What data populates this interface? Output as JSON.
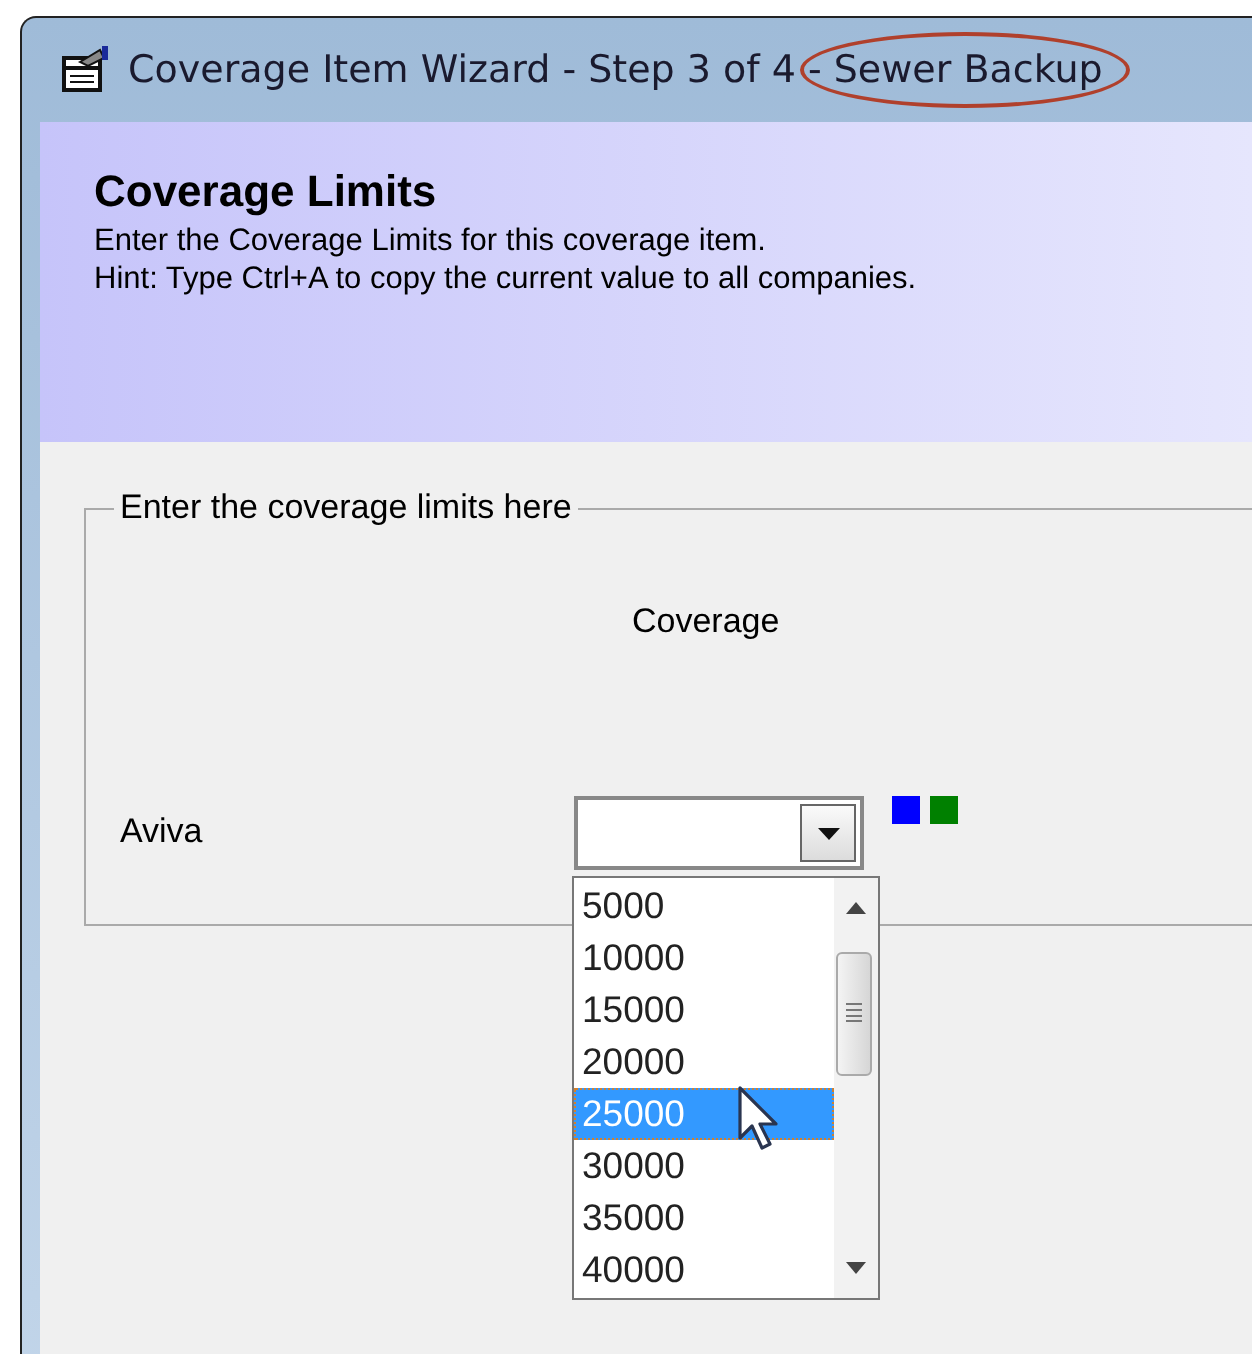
{
  "window": {
    "title": "Coverage Item Wizard - Step 3 of 4",
    "title_highlight": "- Sewer Backup"
  },
  "header": {
    "heading": "Coverage Limits",
    "lines": [
      "Enter the Coverage Limits for this coverage item.",
      "Hint: Type Ctrl+A to copy the current value to all companies."
    ]
  },
  "group": {
    "legend": "Enter the coverage limits here",
    "column_header": "Coverage",
    "rows": [
      {
        "label": "Aviva",
        "markers": [
          {
            "color": "#0000ff"
          },
          {
            "color": "#008000"
          }
        ],
        "dropdown": {
          "expanded": true,
          "options": [
            {
              "label": "5000",
              "selected": false
            },
            {
              "label": "10000",
              "selected": false
            },
            {
              "label": "15000",
              "selected": false
            },
            {
              "label": "20000",
              "selected": false
            },
            {
              "label": "25000",
              "selected": true
            },
            {
              "label": "30000",
              "selected": false
            },
            {
              "label": "35000",
              "selected": false
            },
            {
              "label": "40000",
              "selected": false
            }
          ]
        }
      }
    ]
  }
}
